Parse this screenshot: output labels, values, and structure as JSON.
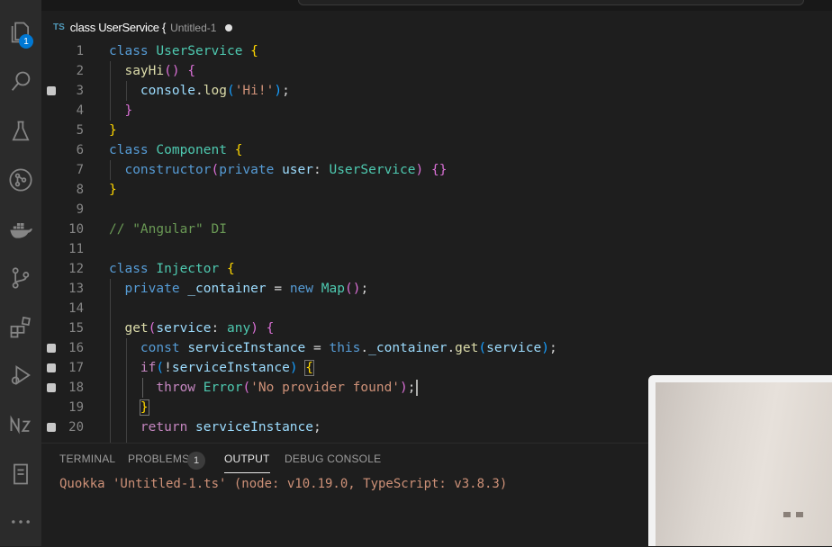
{
  "tab": {
    "lang": "TS",
    "name": "class UserService {",
    "desc": "Untitled-1"
  },
  "activity": {
    "explorer_badge": "1",
    "icons": [
      "files-icon",
      "search-icon",
      "testing-icon",
      "git-icon",
      "docker-icon",
      "source-control-icon",
      "extensions-icon",
      "run-debug-icon",
      "nx-icon",
      "remote-icon",
      "more-icon"
    ]
  },
  "editor": {
    "line_numbers": [
      "1",
      "2",
      "3",
      "4",
      "5",
      "6",
      "7",
      "8",
      "9",
      "10",
      "11",
      "12",
      "13",
      "14",
      "15",
      "16",
      "17",
      "18",
      "19",
      "20"
    ]
  },
  "panel": {
    "tabs": [
      "TERMINAL",
      "PROBLEMS",
      "OUTPUT",
      "DEBUG CONSOLE"
    ],
    "problems_count": "1",
    "output": "Quokka 'Untitled-1.ts' (node: v10.19.0, TypeScript: v3.8.3)"
  }
}
